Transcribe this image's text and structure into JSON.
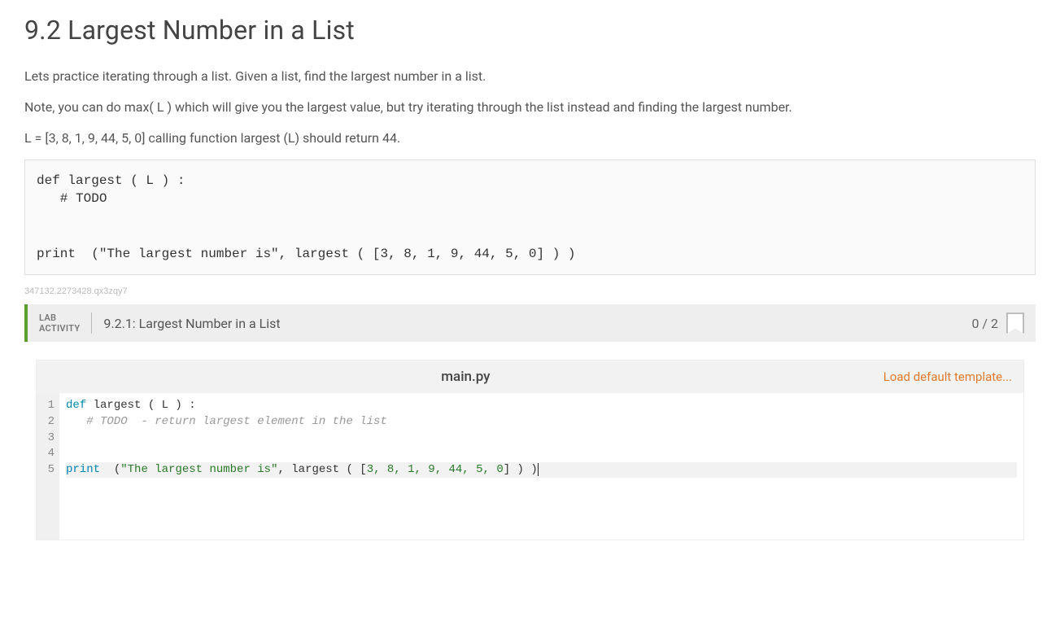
{
  "title": "9.2 Largest Number in a List",
  "p1": "Lets practice iterating through a list. Given a list, find the largest number in a list.",
  "p2": "Note, you can do max( L ) which will give you the largest value, but try iterating through the list instead and finding the largest number.",
  "p3": "L = [3, 8, 1, 9, 44, 5, 0] calling function largest (L) should return 44.",
  "code_block": "def largest ( L ) :\n   # TODO\n\n\nprint  (\"The largest number is\", largest ( [3, 8, 1, 9, 44, 5, 0] ) )",
  "watermark": "347132.2273428.qx3zqy7",
  "lab": {
    "activity_label": "LAB\nACTIVITY",
    "title": "9.2.1: Largest Number in a List",
    "score": "0 / 2"
  },
  "editor": {
    "filename": "main.py",
    "load_default": "Load default template...",
    "line_numbers": [
      "1",
      "2",
      "3",
      "4",
      "5"
    ],
    "lines": {
      "l1_kw": "def",
      "l1_rest": " largest ( L ) :",
      "l2_cm": "   # TODO  - return largest element in the list",
      "l5_kw": "print",
      "l5_sp": "  (",
      "l5_str": "\"The largest number is\"",
      "l5_mid": ", largest ( [",
      "l5_nums": "3, 8, 1, 9, 44, 5, 0",
      "l5_end": "] ) )"
    }
  }
}
